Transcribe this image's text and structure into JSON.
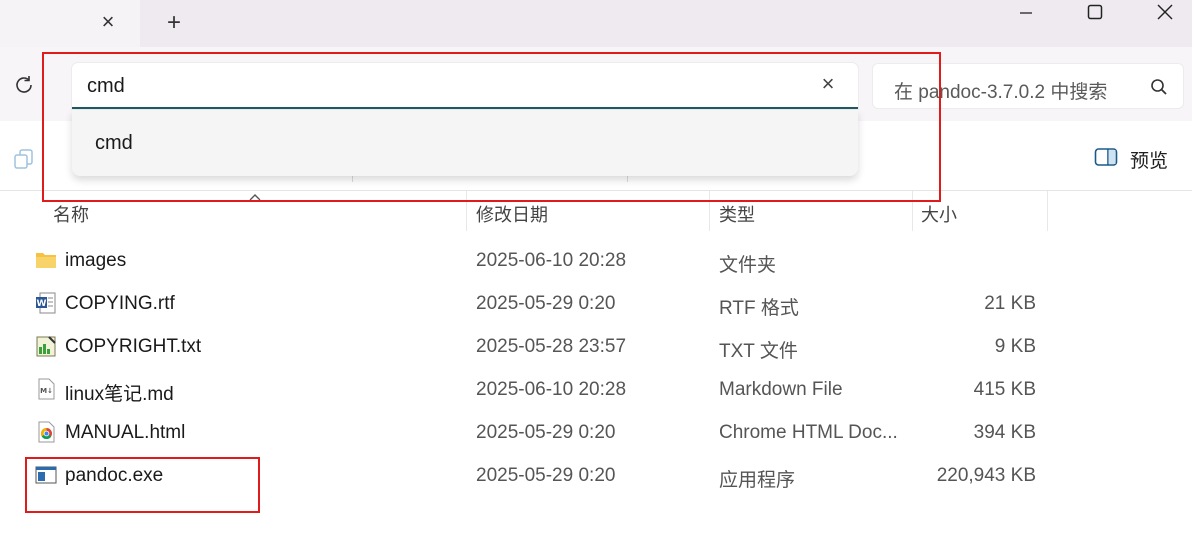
{
  "window": {
    "close_tab_glyph": "×",
    "new_tab_glyph": "+"
  },
  "address": {
    "input_value": "cmd",
    "clear_glyph": "×",
    "suggestion": "cmd"
  },
  "search": {
    "placeholder": "在 pandoc-3.7.0.2 中搜索"
  },
  "toolbar": {
    "preview_label": "预览"
  },
  "columns": {
    "name": "名称",
    "date": "修改日期",
    "type": "类型",
    "size": "大小"
  },
  "files": [
    {
      "name": "images",
      "date": "2025-06-10 20:28",
      "type": "文件夹",
      "size": "",
      "icon": "folder-icon"
    },
    {
      "name": "COPYING.rtf",
      "date": "2025-05-29 0:20",
      "type": "RTF 格式",
      "size": "21 KB",
      "icon": "word-document-icon"
    },
    {
      "name": "COPYRIGHT.txt",
      "date": "2025-05-28 23:57",
      "type": "TXT 文件",
      "size": "9 KB",
      "icon": "text-file-icon"
    },
    {
      "name": "linux笔记.md",
      "date": "2025-06-10 20:28",
      "type": "Markdown File",
      "size": "415 KB",
      "icon": "markdown-file-icon"
    },
    {
      "name": "MANUAL.html",
      "date": "2025-05-29 0:20",
      "type": "Chrome HTML Doc...",
      "size": "394 KB",
      "icon": "chrome-icon"
    },
    {
      "name": "pandoc.exe",
      "date": "2025-05-29 0:20",
      "type": "应用程序",
      "size": "220,943 KB",
      "icon": "application-icon"
    }
  ],
  "colors": {
    "annotation_red": "#e01b1b",
    "accent_underline": "#1e5a63",
    "folder_yellow": "#f5c242"
  }
}
